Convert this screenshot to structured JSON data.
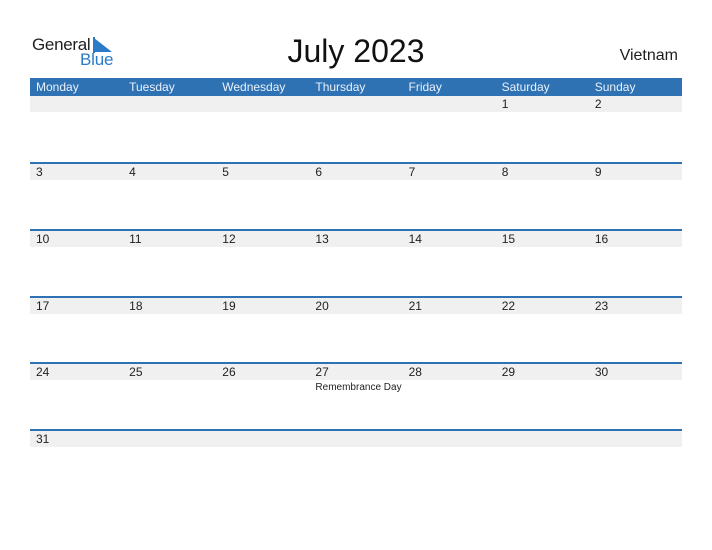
{
  "logo": {
    "line1": "General",
    "line2": "Blue"
  },
  "title": "July 2023",
  "country": "Vietnam",
  "colors": {
    "accent": "#2f72b4",
    "logo_blue": "#2b7bc8",
    "strip_gray": "#f0f0f0"
  },
  "weekdays": [
    "Monday",
    "Tuesday",
    "Wednesday",
    "Thursday",
    "Friday",
    "Saturday",
    "Sunday"
  ],
  "weeks": [
    {
      "days": [
        {
          "num": ""
        },
        {
          "num": ""
        },
        {
          "num": ""
        },
        {
          "num": ""
        },
        {
          "num": ""
        },
        {
          "num": "1"
        },
        {
          "num": "2"
        }
      ]
    },
    {
      "days": [
        {
          "num": "3"
        },
        {
          "num": "4"
        },
        {
          "num": "5"
        },
        {
          "num": "6"
        },
        {
          "num": "7"
        },
        {
          "num": "8"
        },
        {
          "num": "9"
        }
      ]
    },
    {
      "days": [
        {
          "num": "10"
        },
        {
          "num": "11"
        },
        {
          "num": "12"
        },
        {
          "num": "13"
        },
        {
          "num": "14"
        },
        {
          "num": "15"
        },
        {
          "num": "16"
        }
      ]
    },
    {
      "days": [
        {
          "num": "17"
        },
        {
          "num": "18"
        },
        {
          "num": "19"
        },
        {
          "num": "20"
        },
        {
          "num": "21"
        },
        {
          "num": "22"
        },
        {
          "num": "23"
        }
      ]
    },
    {
      "days": [
        {
          "num": "24"
        },
        {
          "num": "25"
        },
        {
          "num": "26"
        },
        {
          "num": "27",
          "event": "Remembrance Day"
        },
        {
          "num": "28"
        },
        {
          "num": "29"
        },
        {
          "num": "30"
        }
      ]
    },
    {
      "days": [
        {
          "num": "31"
        },
        {
          "num": ""
        },
        {
          "num": ""
        },
        {
          "num": ""
        },
        {
          "num": ""
        },
        {
          "num": ""
        },
        {
          "num": ""
        }
      ]
    }
  ]
}
